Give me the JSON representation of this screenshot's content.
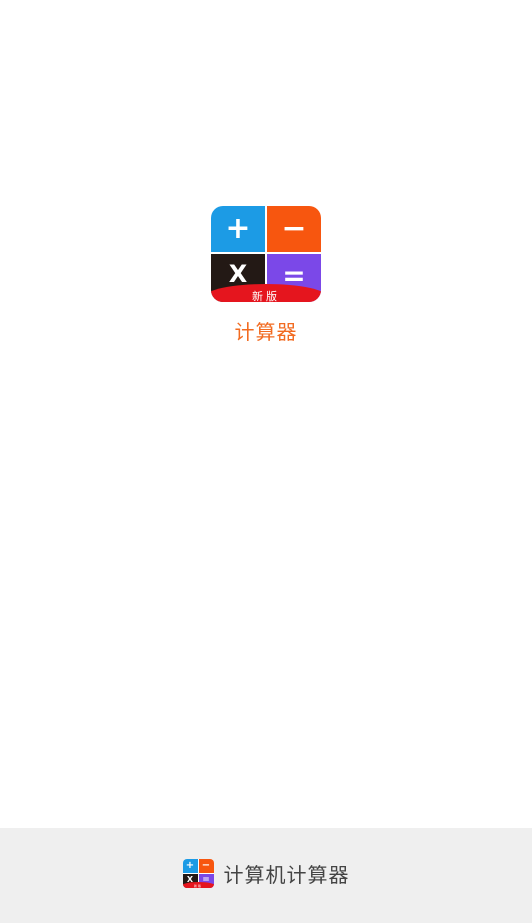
{
  "splash": {
    "app_name": "计算器",
    "logo": {
      "icon": "calculator-logo-icon",
      "symbols": {
        "plus": "+",
        "minus": "−",
        "times": "X",
        "equals": "="
      },
      "badge": "新版",
      "colors": {
        "plus_tile": "#1c9be5",
        "minus_tile": "#f7560f",
        "times_tile": "#231915",
        "equals_tile": "#7b48e8",
        "badge_ribbon": "#e5151e"
      }
    },
    "title_color": "#f26b21"
  },
  "footer": {
    "brand_text": "计算机计算器",
    "icon": "calculator-logo-icon",
    "background": "#efefef"
  }
}
